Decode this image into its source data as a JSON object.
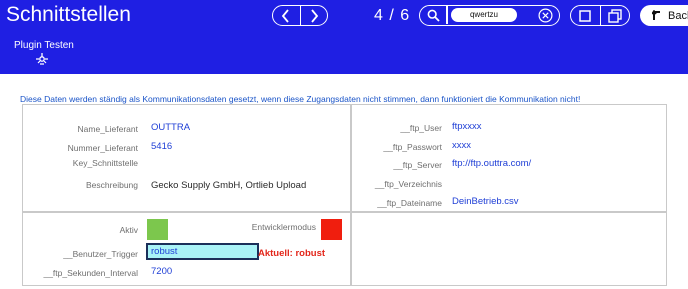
{
  "header": {
    "title": "Schnittstellen",
    "record_counter": "4 / 6",
    "search_value": "qwertzu",
    "back_label": "Back",
    "plugin_label": "Plugin Testen",
    "bg_color": "#1f1fe3"
  },
  "info_text": "Diese Daten werden ständig als Kommunikationsdaten gesetzt, wenn diese Zugangsdaten nicht stimmen, dann funktioniert die Kommunikation nicht!",
  "lieferant": {
    "name_label": "Name_Lieferant",
    "name_value": "OUTTRA",
    "nummer_label": "Nummer_Lieferant",
    "nummer_value": "5416",
    "schnittstelle_label": "Key_Schnittstelle",
    "beschreibung_label": "Beschreibung",
    "beschreibung_value": "Gecko Supply GmbH, Ortlieb Upload"
  },
  "ftp": {
    "user_label": "__ftp_User",
    "user_value": "ftpxxxx",
    "passwort_label": "__ftp_Passwort",
    "passwort_value": "xxxx",
    "server_label": "__ftp_Server",
    "server_value": "ftp://ftp.outtra.com/",
    "verzeichnis_label": "__ftp_Verzeichnis",
    "dateiname_label": "__ftp_Dateiname",
    "dateiname_value": "DeinBetrieb.csv"
  },
  "settings": {
    "aktiv_label": "Aktiv",
    "aktiv_color": "#7cc74d",
    "entwickler_label": "Entwicklermodus",
    "entwickler_color": "#f01e0e",
    "trigger_label": "__Benutzer_Trigger",
    "trigger_value": "robust",
    "trigger_current": "Aktuell: robust",
    "interval_label": "__ftp_Sekunden_Interval",
    "interval_value": "7200"
  },
  "icons": {
    "prev": "chevron-left-icon",
    "next": "chevron-right-icon",
    "search": "search-icon",
    "clear": "clear-icon",
    "single_view": "square-icon",
    "multi_view": "stacked-squares-icon",
    "back": "back-arrow-icon",
    "plugin": "plugin-icon"
  }
}
